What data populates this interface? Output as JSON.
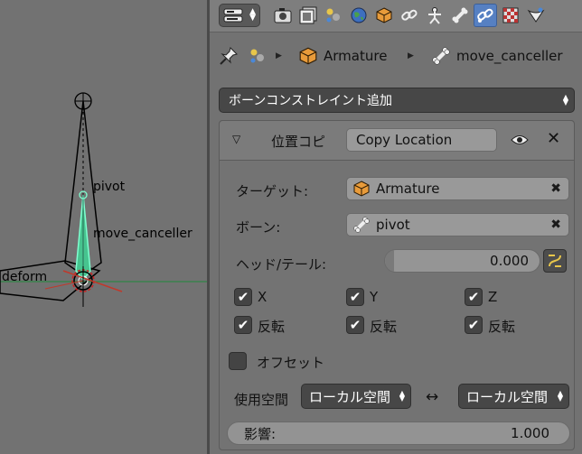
{
  "viewport": {
    "labels": {
      "pivot": "pivot",
      "move_canceller": "move_canceller",
      "deform": "deform"
    },
    "colors": {
      "bone_active": "#3fbf8f",
      "x_axis": "#c0392b",
      "y_axis": "#27ae60",
      "cursor": "#cc2020"
    }
  },
  "toolbar": {
    "editor_type_icon": "properties-editor-icon",
    "tabs": [
      {
        "icon": "render-icon",
        "active": false
      },
      {
        "icon": "render-layers-icon",
        "active": false
      },
      {
        "icon": "scene-icon",
        "active": false
      },
      {
        "icon": "world-icon",
        "active": false
      },
      {
        "icon": "object-icon",
        "active": false
      },
      {
        "icon": "constraint-icon",
        "active": false
      },
      {
        "icon": "object-data-armature-icon",
        "active": false
      },
      {
        "icon": "bone-icon",
        "active": false
      },
      {
        "icon": "bone-constraint-icon",
        "active": true
      },
      {
        "icon": "texture-icon",
        "active": false
      },
      {
        "icon": "particles-icon",
        "active": false
      }
    ]
  },
  "breadcrumb": {
    "object": "Armature",
    "bone": "move_canceller"
  },
  "add_constraint": {
    "label": "ボーンコンストレイント追加"
  },
  "constraint": {
    "type_label": "位置コピ",
    "name": "Copy Location",
    "target_label": "ターゲット:",
    "target_value": "Armature",
    "bone_label": "ボーン:",
    "bone_value": "pivot",
    "head_tail_label": "ヘッド/テール:",
    "head_tail_value": "0.000",
    "axes": [
      {
        "label": "X",
        "checked": true
      },
      {
        "label": "Y",
        "checked": true
      },
      {
        "label": "Z",
        "checked": true
      }
    ],
    "invert": [
      {
        "label": "反転",
        "checked": true
      },
      {
        "label": "反転",
        "checked": true
      },
      {
        "label": "反転",
        "checked": true
      }
    ],
    "offset_label": "オフセット",
    "offset_checked": false,
    "space_label": "使用空間",
    "owner_space": "ローカル空間",
    "target_space": "ローカル空間",
    "space_arrow": "↔",
    "influence_label": "影響:",
    "influence_value": "1.000"
  },
  "colors": {
    "active_tab": "#5680c2",
    "dropdown_dark": "#474747",
    "field_bg": "#999999"
  }
}
